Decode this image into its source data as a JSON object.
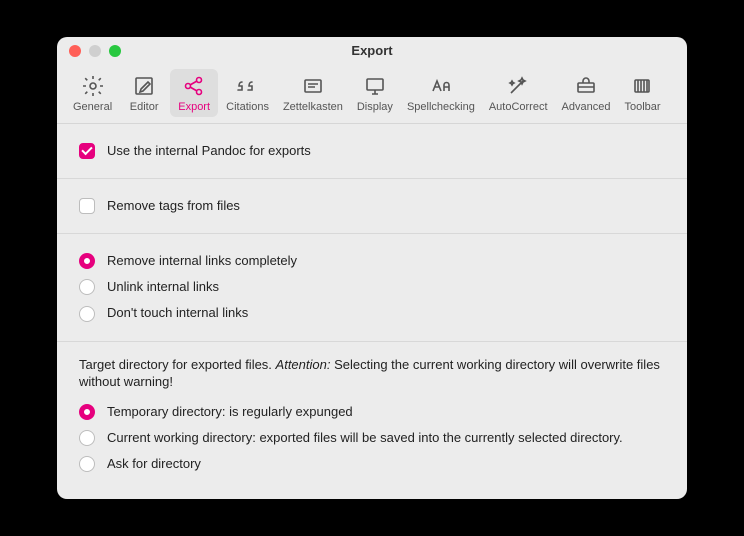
{
  "window": {
    "title": "Export"
  },
  "toolbar": {
    "items": [
      {
        "id": "general",
        "label": "General"
      },
      {
        "id": "editor",
        "label": "Editor"
      },
      {
        "id": "export",
        "label": "Export"
      },
      {
        "id": "citations",
        "label": "Citations"
      },
      {
        "id": "zettelkasten",
        "label": "Zettelkasten"
      },
      {
        "id": "display",
        "label": "Display"
      },
      {
        "id": "spellchecking",
        "label": "Spellchecking"
      },
      {
        "id": "autocorrect",
        "label": "AutoCorrect"
      },
      {
        "id": "advanced",
        "label": "Advanced"
      },
      {
        "id": "toolbar",
        "label": "Toolbar"
      }
    ],
    "active": "export"
  },
  "options": {
    "use_internal_pandoc": {
      "label": "Use the internal Pandoc for exports",
      "checked": true
    },
    "remove_tags": {
      "label": "Remove tags from files",
      "checked": false
    },
    "internal_links": {
      "selected": "remove",
      "remove": "Remove internal links completely",
      "unlink": "Unlink internal links",
      "dont": "Don't touch internal links"
    },
    "target_dir": {
      "note_pre": "Target directory for exported files. ",
      "note_em": "Attention:",
      "note_post": " Selecting the current working directory will overwrite files without warning!",
      "selected": "temp",
      "temp": "Temporary directory: is regularly expunged",
      "cwd": "Current working directory: exported files will be saved into the currently selected directory.",
      "ask": "Ask for directory"
    }
  }
}
